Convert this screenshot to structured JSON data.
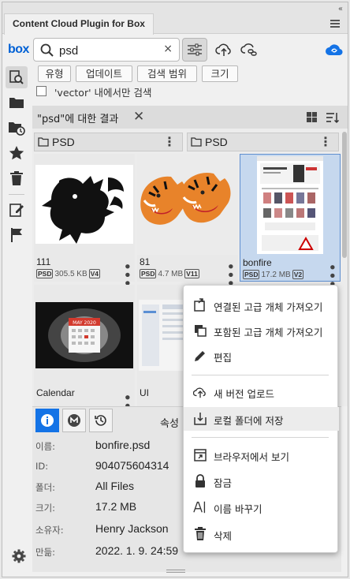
{
  "window": {
    "title": "Content Cloud Plugin for Box",
    "collapse": "«"
  },
  "rail": {
    "logo": "box",
    "items": [
      "search-icon",
      "folder-icon",
      "recent-folder-icon",
      "star-icon",
      "trash-icon",
      "edit-icon",
      "flag-icon"
    ],
    "settings": "gear-icon"
  },
  "search": {
    "value": "psd",
    "clear": "×"
  },
  "filters": {
    "chips": [
      "유형",
      "업데이트",
      "검색 범위",
      "크기"
    ],
    "vector_only_label": "'vector' 내에서만 검색"
  },
  "results": {
    "title": "\"psd\"에 대한 결과",
    "close": "✕",
    "folders": [
      {
        "name": "PSD"
      },
      {
        "name": "PSD"
      }
    ],
    "files": [
      {
        "name": "111",
        "type": "PSD",
        "size": "305.5 KB",
        "version": "V4"
      },
      {
        "name": "81",
        "type": "PSD",
        "size": "4.7 MB",
        "version": "V11"
      },
      {
        "name": "bonfire",
        "type": "PSD",
        "size": "17.2 MB",
        "version": "V2",
        "selected": true
      },
      {
        "name": "Calendar"
      },
      {
        "name": "UI"
      }
    ],
    "calendar_thumb_label": "MAY 2020"
  },
  "details": {
    "heading": "속성",
    "rows": [
      {
        "label": "이름:",
        "value": "bonfire.psd"
      },
      {
        "label": "ID:",
        "value": "904075604314"
      },
      {
        "label": "폴더:",
        "value": "All Files"
      },
      {
        "label": "크기:",
        "value": "17.2 MB"
      },
      {
        "label": "소유자:",
        "value": "Henry Jackson"
      },
      {
        "label": "만듦:",
        "value": "2022. 1. 9. 24:59"
      }
    ]
  },
  "context_menu": {
    "items": [
      {
        "label": "연결된 고급 개체 가져오기",
        "icon": "linked-object-icon"
      },
      {
        "label": "포함된 고급 개체 가져오기",
        "icon": "embedded-object-icon"
      },
      {
        "label": "편집",
        "icon": "pencil-icon"
      },
      {
        "label": "새 버전 업로드",
        "icon": "cloud-upload-icon"
      },
      {
        "label": "로컬 폴더에 저장",
        "icon": "save-local-icon",
        "hover": true
      },
      {
        "label": "브라우저에서 보기",
        "icon": "browser-icon"
      },
      {
        "label": "잠금",
        "icon": "lock-icon"
      },
      {
        "label": "이름 바꾸기",
        "icon": "rename-icon"
      },
      {
        "label": "삭제",
        "icon": "trash-icon"
      }
    ]
  },
  "colors": {
    "accent": "#1473e6",
    "box_blue": "#0061d5",
    "selection": "#c6d8ee"
  }
}
